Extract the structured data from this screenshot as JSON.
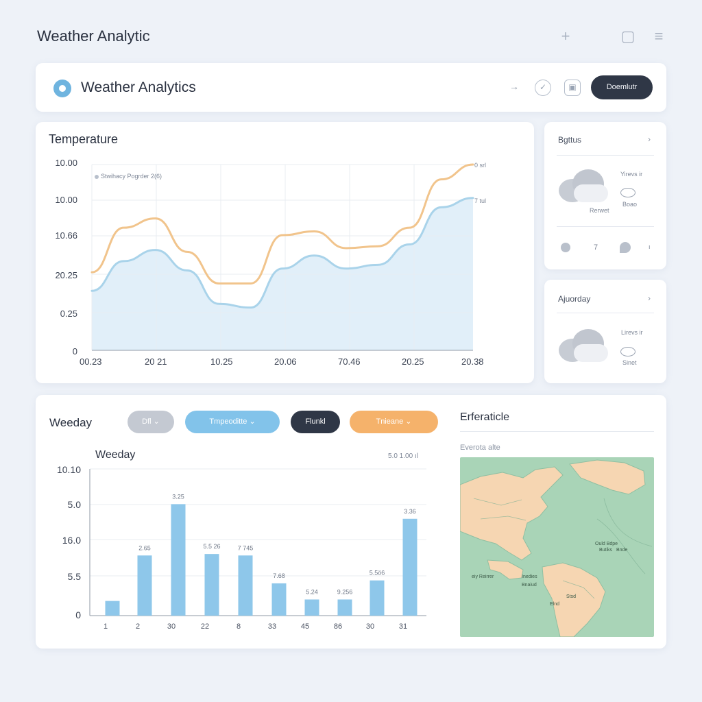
{
  "app": {
    "title": "Weather Analytic"
  },
  "top_icons": {
    "add": "+",
    "window": "▢",
    "menu": "≡"
  },
  "header": {
    "title": "Weather Analytics",
    "arrow": "→",
    "check": "✓",
    "square": "▣",
    "button": "Doemlutr"
  },
  "temperature": {
    "title": "Temperature",
    "legend": "Stwihacy Pogrder 2(6)",
    "end_label_orange": "0 srl",
    "end_label_blue": "7 tul",
    "chart_data": {
      "type": "line",
      "y_tick_labels": [
        "10.00",
        "10.00",
        "10.66",
        "20.25",
        "0.25",
        "0"
      ],
      "x_tick_labels": [
        "00.23",
        "20 21",
        "10.25",
        "20.06",
        "70.46",
        "20.25",
        "20.38"
      ],
      "series": [
        {
          "color": "#f1c48c",
          "values": [
            0.42,
            0.66,
            0.71,
            0.53,
            0.36,
            0.36,
            0.62,
            0.64,
            0.55,
            0.56,
            0.66,
            0.92,
            1.0
          ]
        },
        {
          "color": "#a9d3ea",
          "values": [
            0.32,
            0.48,
            0.54,
            0.43,
            0.25,
            0.23,
            0.44,
            0.51,
            0.44,
            0.46,
            0.57,
            0.77,
            0.82
          ]
        }
      ]
    }
  },
  "side1": {
    "title": "Bgttus",
    "chevron": "›",
    "cloud_label": "Rerwet",
    "right_top": "Yirevs ir",
    "right_bottom": "Boao",
    "footer_num": "7",
    "footer_end": "ı"
  },
  "side2": {
    "title": "Ajuorday",
    "chevron": "›",
    "right_top": "Lirevs ir",
    "right_bottom": "Sinet"
  },
  "weekday": {
    "title": "Weeday",
    "chart_title": "Weeday",
    "chart_note": "5.0 1.00 ıl",
    "pills": [
      {
        "label": "Dfl",
        "suffix": "⌄",
        "bg": "#c4c9d2",
        "fg": "#ffffff"
      },
      {
        "label": "Tmpeoditte",
        "suffix": "⌄",
        "bg": "#82c3ea",
        "fg": "#ffffff"
      },
      {
        "label": "Flunkl",
        "suffix": "",
        "bg": "#2f3746",
        "fg": "#ffffff"
      },
      {
        "label": "Tnieane",
        "suffix": "⌄",
        "bg": "#f5b26b",
        "fg": "#ffffff"
      }
    ],
    "chart_data": {
      "type": "bar",
      "y_tick_labels": [
        "10.10",
        "5.0",
        "16.0",
        "5.5",
        "0"
      ],
      "categories": [
        "1",
        "2",
        "30",
        "22",
        "8",
        "33",
        "45",
        "86",
        "30",
        "31"
      ],
      "values": [
        0.1,
        0.41,
        0.76,
        0.42,
        0.41,
        0.22,
        0.11,
        0.11,
        0.24,
        0.66
      ],
      "value_labels": [
        "",
        "2.65",
        "3.25",
        "5.5 26",
        "7 745",
        "7.68",
        "5.24",
        "9.256",
        "5.5ö6",
        "3.36"
      ]
    }
  },
  "map_panel": {
    "title": "Erferaticle",
    "subtitle": "Everota alte",
    "labels": [
      "Ould Bdpe",
      "Butiks",
      "Bnde",
      "eiy Reirrer",
      "Inedies",
      "Bnaiud",
      "Stsd",
      "Elnd"
    ]
  }
}
